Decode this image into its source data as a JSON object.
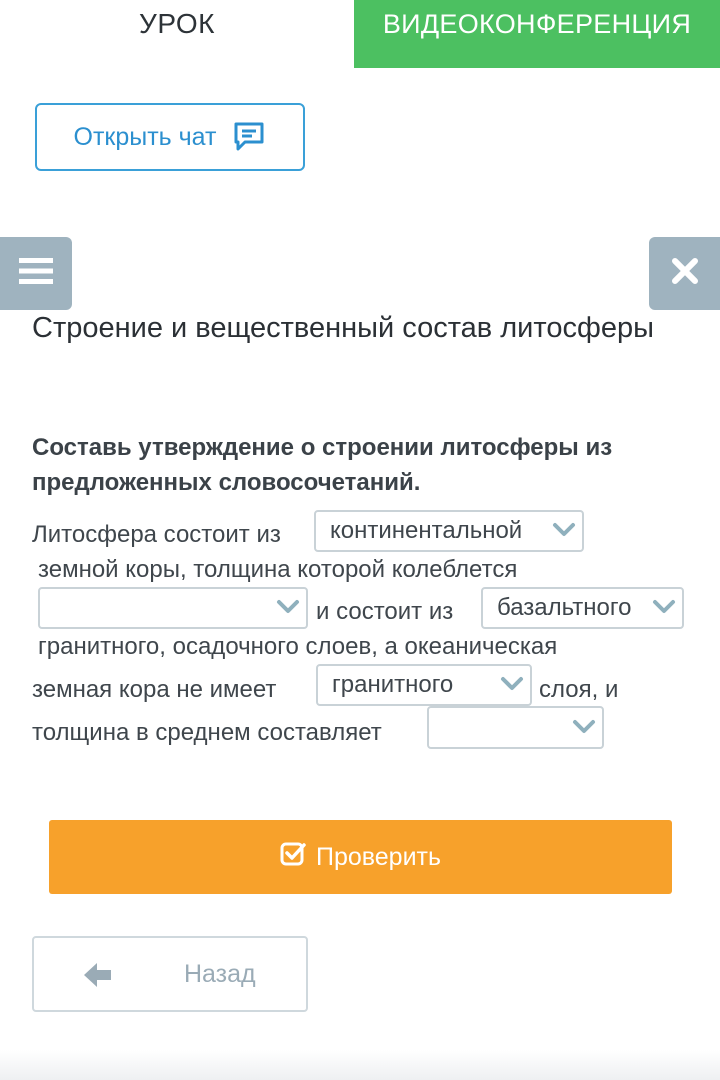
{
  "tabs": {
    "lesson": "УРОК",
    "video": "ВИДЕОКОНФЕРЕНЦИЯ"
  },
  "chat": {
    "label": "Открыть чат",
    "icon": "chat-icon"
  },
  "side": {
    "menu_icon": "hamburger-menu-icon",
    "close_icon": "close-icon"
  },
  "title": "Строение и вещественный состав литосферы",
  "instruction": "Составь утверждение о строении литосферы из предложенных словосочетаний.",
  "sentence": {
    "t1": "Литосфера состоит из",
    "t2": "земной коры, толщина которой колеблется",
    "t3": "и состоит из",
    "t4": "гранитного, осадочного слоев, а океаническая",
    "t5": "земная кора не имеет",
    "t6": "слоя, и",
    "t7": "толщина в среднем составляет"
  },
  "dropdowns": {
    "d1": "континентальной",
    "d2": "",
    "d3": "базальтного",
    "d4": "гранитного",
    "d5": ""
  },
  "actions": {
    "check": "Проверить",
    "back": "Назад"
  },
  "colors": {
    "green": "#4cc061",
    "blue": "#3aa0d8",
    "orange": "#f7a12b",
    "slate": "#9fb3bf"
  }
}
